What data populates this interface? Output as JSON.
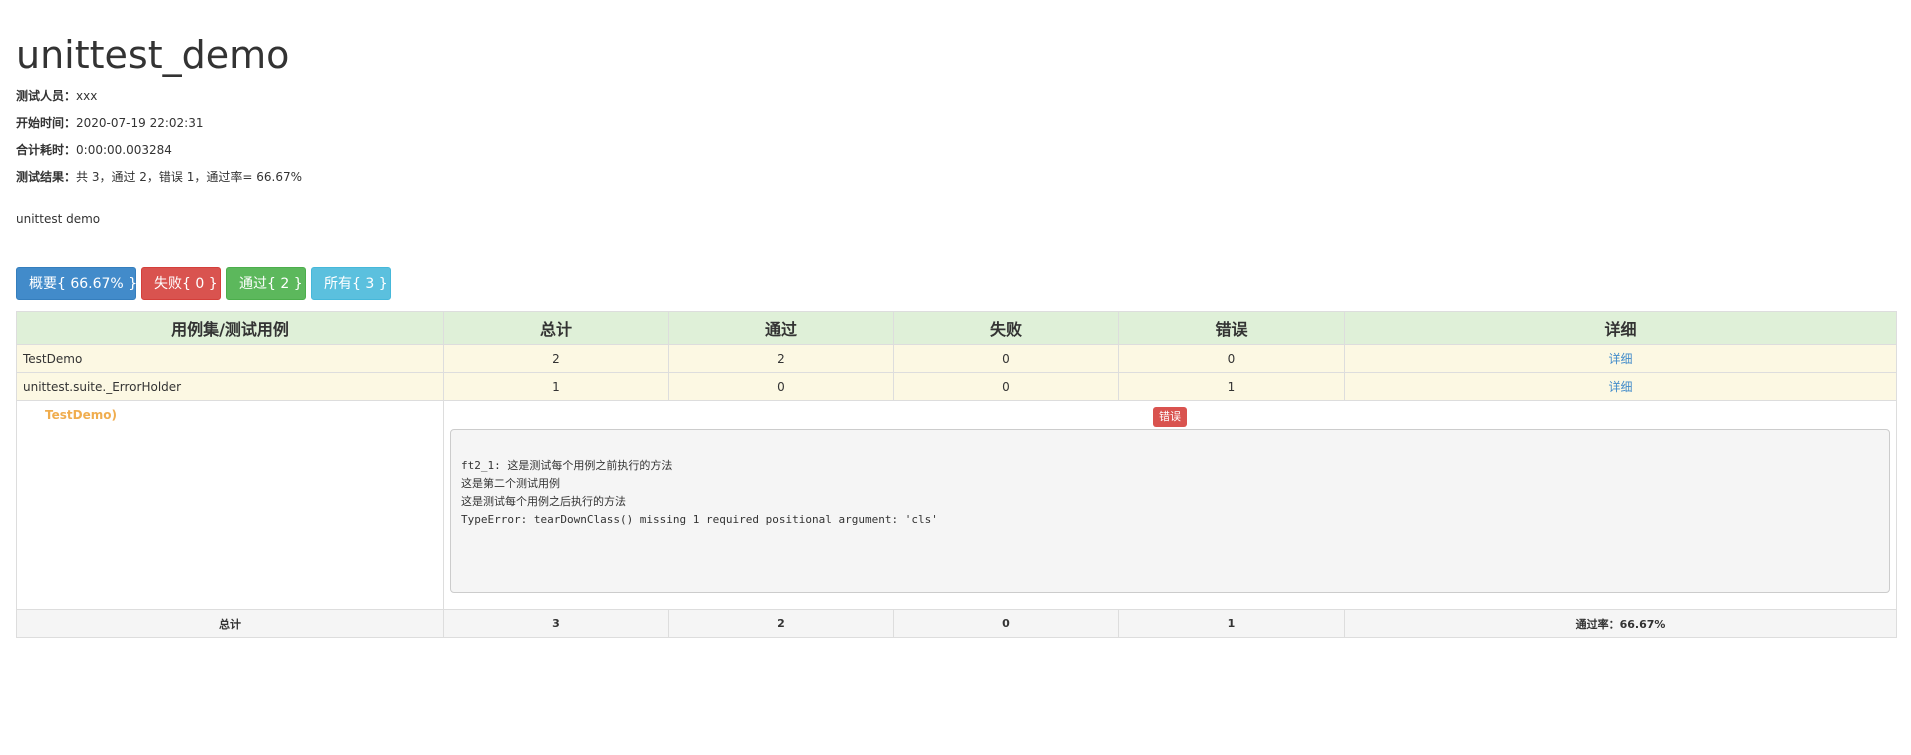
{
  "report": {
    "title": "unittest_demo",
    "meta": [
      {
        "label": "测试人员：",
        "value": "xxx"
      },
      {
        "label": "开始时间：",
        "value": "2020-07-19 22:02:31"
      },
      {
        "label": "合计耗时：",
        "value": "0:00:00.003284"
      },
      {
        "label": "测试结果：",
        "value": "共 3，通过 2，错误 1，通过率= 66.67%"
      }
    ],
    "description": "unittest demo"
  },
  "filters": {
    "summary": "概要{ 66.67% }",
    "fail": "失败{ 0 }",
    "pass": "通过{ 2 }",
    "all": "所有{ 3 }"
  },
  "table": {
    "headers": [
      "用例集/测试用例",
      "总计",
      "通过",
      "失败",
      "错误",
      "详细"
    ],
    "rows": [
      {
        "name": "TestDemo",
        "total": "2",
        "pass": "2",
        "fail": "0",
        "error": "0",
        "detail": "详细"
      },
      {
        "name": "unittest.suite._ErrorHolder",
        "total": "1",
        "pass": "0",
        "fail": "0",
        "error": "1",
        "detail": "详细"
      }
    ],
    "case": {
      "name": "TestDemo)",
      "badge": "错误",
      "log": "ft2_1: 这是测试每个用例之前执行的方法\n这是第二个测试用例\n这是测试每个用例之后执行的方法\nTypeError: tearDownClass() missing 1 required positional argument: 'cls'"
    },
    "totals": {
      "label": "总计",
      "total": "3",
      "pass": "2",
      "fail": "0",
      "error": "1",
      "rate": "通过率：66.67%"
    }
  },
  "colors": {
    "primary": "#428bca",
    "danger": "#d9534f",
    "success": "#5cb85c",
    "info": "#5bc0de",
    "warning": "#f0ad4e",
    "header_bg": "#dff0d8",
    "suite_bg": "#fcf8e3"
  }
}
